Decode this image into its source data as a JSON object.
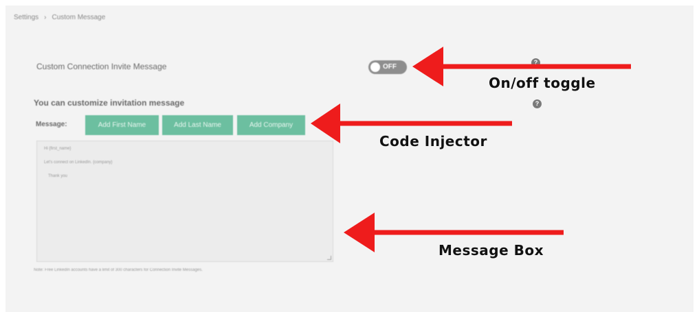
{
  "breadcrumb": {
    "root": "Settings",
    "separator": "›",
    "current": "Custom Message"
  },
  "setting": {
    "title": "Custom Connection Invite Message",
    "toggle_state": "OFF",
    "help_icon": "question-icon"
  },
  "customize": {
    "heading": "You can customize invitation message",
    "message_label": "Message:",
    "buttons": [
      "Add First Name",
      "Add Last Name",
      "Add Company"
    ]
  },
  "message_box": {
    "lines": [
      "Hi {first_name}",
      "Let's connect on LinkedIn. {company}",
      "Thank you"
    ]
  },
  "note": "Note: Free LinkedIn accounts have a limit of 300 characters for Connection Invite Messages.",
  "annotations": {
    "toggle": "On/off toggle",
    "injector": "Code Injector",
    "message": "Message Box"
  },
  "colors": {
    "button_green": "#6cbfa0",
    "arrow_red": "#ee1c1c",
    "toggle_off": "#8e8e8e",
    "panel_bg": "#f3f3f3"
  }
}
